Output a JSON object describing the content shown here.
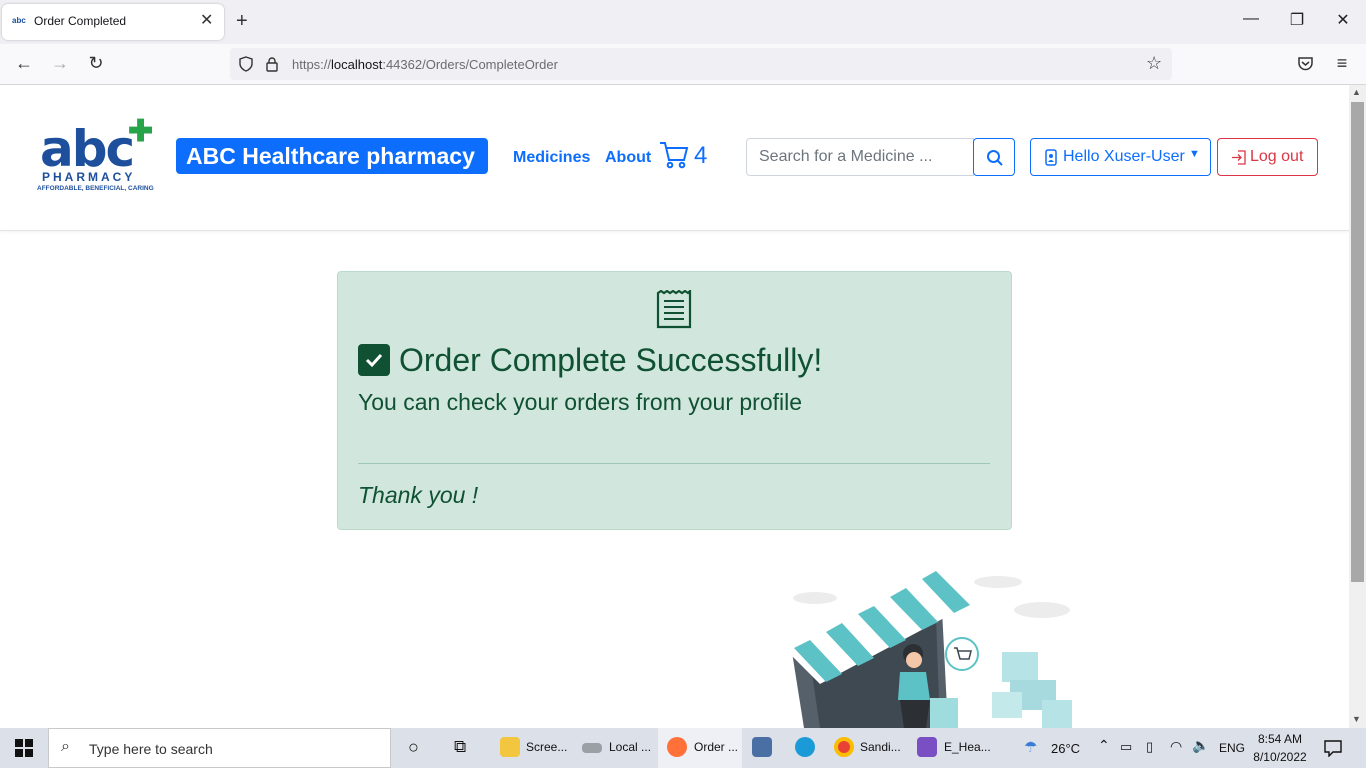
{
  "browser": {
    "tab_title": "Order Completed",
    "tab_favicon_text": "abc",
    "url_prefix": "https://",
    "url_host": "localhost",
    "url_path": ":44362/Orders/CompleteOrder"
  },
  "header": {
    "logo_text": "abc",
    "logo_pharmacy": "PHARMACY",
    "logo_tagline": "AFFORDABLE, BENEFICIAL, CARING",
    "brand": "ABC Healthcare pharmacy",
    "nav": [
      {
        "label": "Medicines"
      },
      {
        "label": "About"
      }
    ],
    "cart_count": "4",
    "search_placeholder": "Search for a Medicine ...",
    "user_label": "Hello Xuser-User",
    "logout_label": "Log out"
  },
  "alert": {
    "heading": "Order Complete Successfully!",
    "message": "You can check your orders from your profile",
    "thanks": "Thank you !"
  },
  "taskbar": {
    "search_placeholder": "Type here to search",
    "apps": [
      {
        "label": "Scree..."
      },
      {
        "label": "Local ..."
      },
      {
        "label": "Order ..."
      },
      {
        "label": "Sandi..."
      },
      {
        "label": "E_Hea..."
      }
    ],
    "weather": "26°C",
    "language": "ENG",
    "time": "8:54 AM",
    "date": "8/10/2022"
  },
  "colors": {
    "primary": "#0d6efd",
    "success_bg": "#d1e7dd",
    "success_text": "#0f5132",
    "danger": "#dc3545"
  }
}
